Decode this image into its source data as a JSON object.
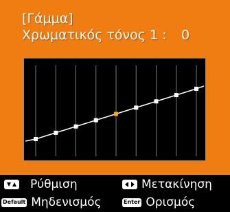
{
  "screen": {
    "title": "[Γάμμα]",
    "tone_label": "Χρωματικός τόνος 1 :",
    "tone_value": "0",
    "colors": {
      "background": "#f07d11",
      "graph_background": "#000000",
      "grid": "#7a7a7a",
      "curve": "#ffffff",
      "point": "#ffffff",
      "selected_point": "#f5a623"
    }
  },
  "gamma_curve": {
    "points": [
      {
        "value": 0,
        "selected": false
      },
      {
        "value": 1,
        "selected": false
      },
      {
        "value": 2,
        "selected": false
      },
      {
        "value": 3,
        "selected": false
      },
      {
        "value": 4,
        "selected": true
      },
      {
        "value": 5,
        "selected": false
      },
      {
        "value": 6,
        "selected": false
      },
      {
        "value": 7,
        "selected": false
      },
      {
        "value": 8,
        "selected": false
      }
    ],
    "grid_columns": 8
  },
  "footer": {
    "adjust": {
      "icon": "up-down-arrows-icon",
      "label": "Ρύθμιση"
    },
    "move": {
      "icon": "left-right-arrows-icon",
      "label": "Μετακίνηση"
    },
    "reset": {
      "icon": "default-key-icon",
      "key": "Default",
      "label": "Μηδενισμός"
    },
    "set": {
      "icon": "enter-key-icon",
      "key": "Enter",
      "label": "Ορισμός"
    }
  }
}
